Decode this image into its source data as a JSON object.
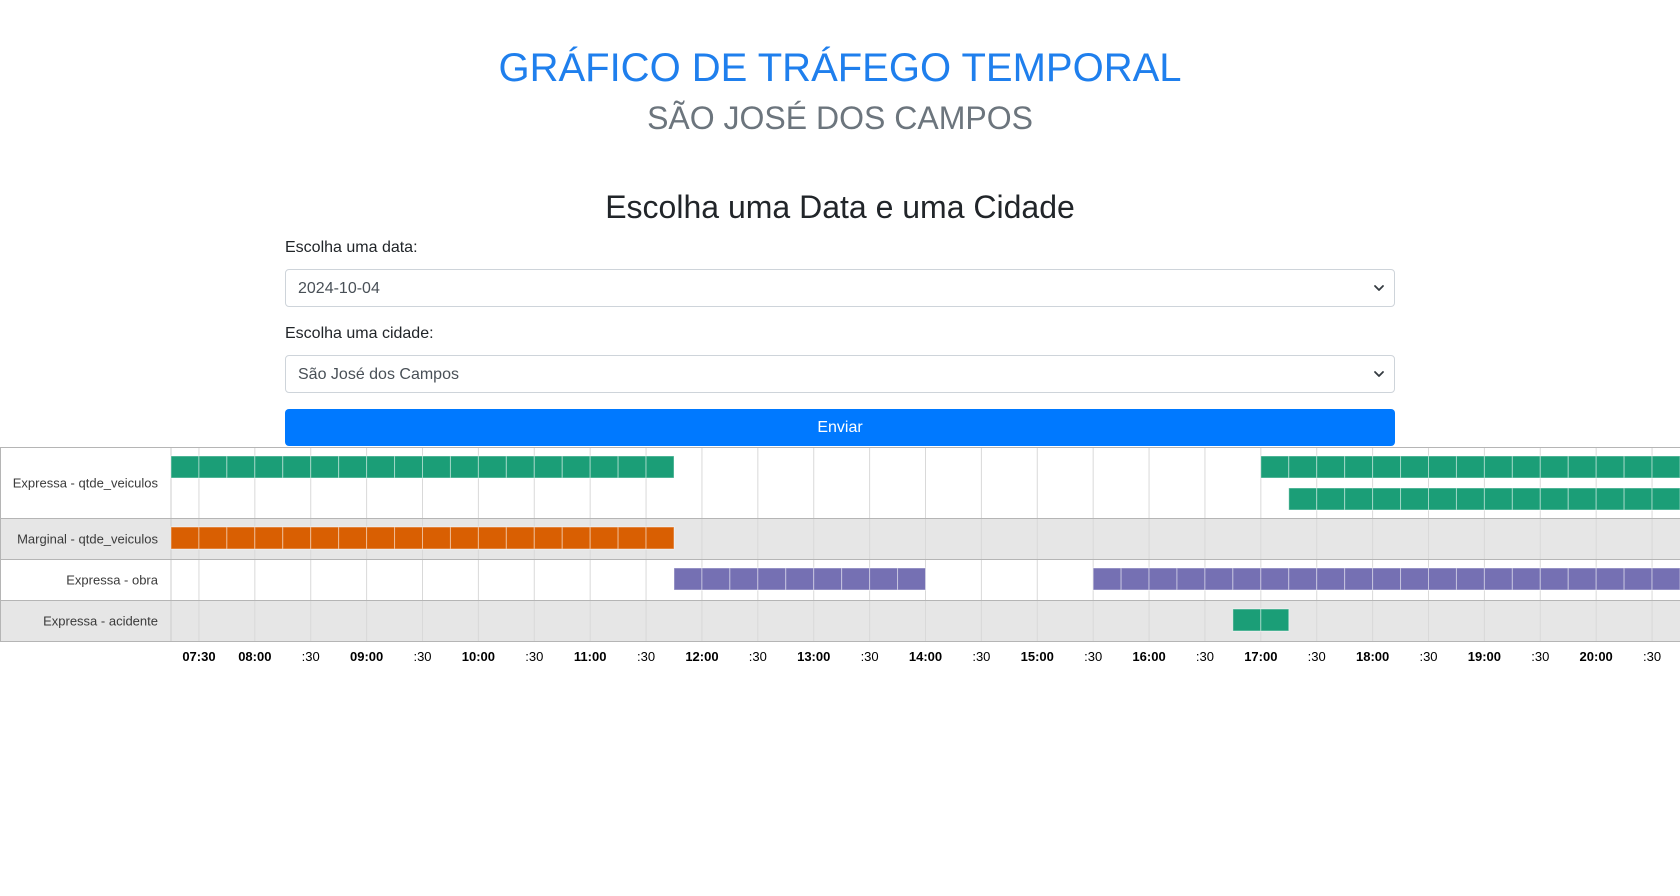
{
  "header": {
    "title": "GRÁFICO DE TRÁFEGO TEMPORAL",
    "subtitle": "SÃO JOSÉ DOS CAMPOS"
  },
  "form": {
    "heading": "Escolha uma Data e uma Cidade",
    "date_label": "Escolha uma data:",
    "date_value": "2024-10-04",
    "city_label": "Escolha uma cidade:",
    "city_value": "São José dos Campos",
    "submit_label": "Enviar"
  },
  "chart_data": {
    "type": "timeline",
    "time_unit": "HH:MM",
    "x_range": [
      "07:15",
      "20:45"
    ],
    "slot_minutes": 15,
    "ticks": [
      {
        "time": "07:30",
        "label": "07:30"
      },
      {
        "time": "08:00",
        "label": "08:00"
      },
      {
        "time": "08:30",
        "label": ":30"
      },
      {
        "time": "09:00",
        "label": "09:00"
      },
      {
        "time": "09:30",
        "label": ":30"
      },
      {
        "time": "10:00",
        "label": "10:00"
      },
      {
        "time": "10:30",
        "label": ":30"
      },
      {
        "time": "11:00",
        "label": "11:00"
      },
      {
        "time": "11:30",
        "label": ":30"
      },
      {
        "time": "12:00",
        "label": "12:00"
      },
      {
        "time": "12:30",
        "label": ":30"
      },
      {
        "time": "13:00",
        "label": "13:00"
      },
      {
        "time": "13:30",
        "label": ":30"
      },
      {
        "time": "14:00",
        "label": "14:00"
      },
      {
        "time": "14:30",
        "label": ":30"
      },
      {
        "time": "15:00",
        "label": "15:00"
      },
      {
        "time": "15:30",
        "label": ":30"
      },
      {
        "time": "16:00",
        "label": "16:00"
      },
      {
        "time": "16:30",
        "label": ":30"
      },
      {
        "time": "17:00",
        "label": "17:00"
      },
      {
        "time": "17:30",
        "label": ":30"
      },
      {
        "time": "18:00",
        "label": "18:00"
      },
      {
        "time": "18:30",
        "label": ":30"
      },
      {
        "time": "19:00",
        "label": "19:00"
      },
      {
        "time": "19:30",
        "label": ":30"
      },
      {
        "time": "20:00",
        "label": "20:00"
      },
      {
        "time": "20:30",
        "label": ":30"
      }
    ],
    "rows": [
      {
        "name": "Expressa - qtde_veiculos",
        "color": "#1b9e77",
        "tracks": [
          [
            {
              "start": "07:15",
              "end": "11:45"
            },
            {
              "start": "17:00",
              "end": "20:45"
            }
          ],
          [
            {
              "start": "17:15",
              "end": "20:45"
            }
          ]
        ]
      },
      {
        "name": "Marginal - qtde_veiculos",
        "color": "#d95f02",
        "tracks": [
          [
            {
              "start": "07:15",
              "end": "11:45"
            }
          ]
        ]
      },
      {
        "name": "Expressa - obra",
        "color": "#7570b3",
        "tracks": [
          [
            {
              "start": "11:45",
              "end": "14:00"
            },
            {
              "start": "15:30",
              "end": "20:45"
            }
          ]
        ]
      },
      {
        "name": "Expressa - acidente",
        "color": "#1b9e77",
        "tracks": [
          [
            {
              "start": "16:45",
              "end": "17:15"
            }
          ]
        ]
      }
    ]
  }
}
